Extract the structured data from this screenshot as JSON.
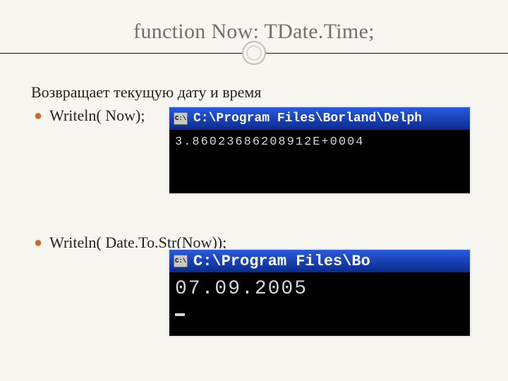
{
  "title": "function Now: TDate.Time;",
  "description": "Возвращает текущую дату и время",
  "bullets": [
    "Writeln( Now);",
    "Writeln( Date.To.Str(Now));"
  ],
  "console1": {
    "title_path": "C:\\Program Files\\Borland\\Delph",
    "output": " 3.86023686208912E+0004"
  },
  "console2": {
    "title_path": "C:\\Program Files\\Bo",
    "output": "07.09.2005"
  }
}
